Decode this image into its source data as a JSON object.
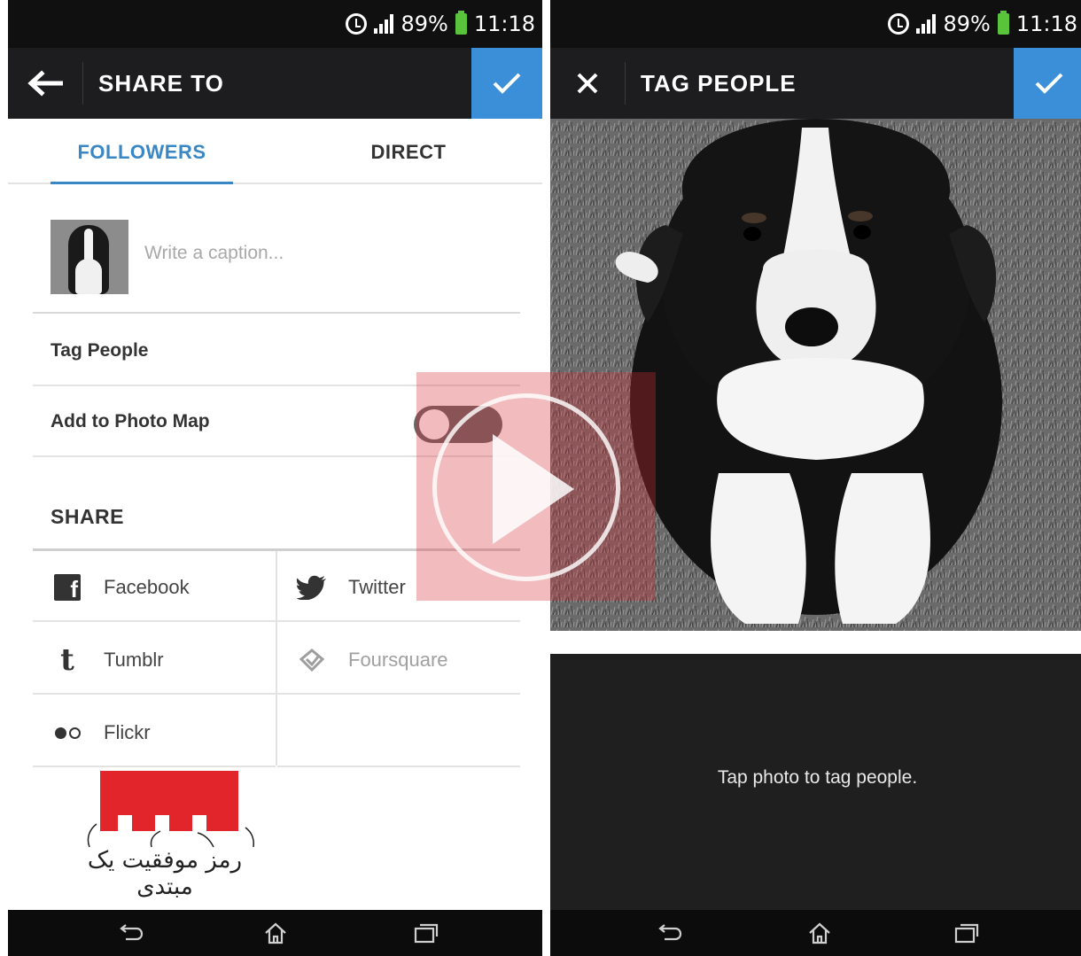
{
  "status_bar": {
    "battery": "89%",
    "time": "11:18"
  },
  "share_screen": {
    "title": "SHARE TO",
    "tabs": [
      {
        "label": "FOLLOWERS",
        "active": true
      },
      {
        "label": "DIRECT",
        "active": false
      }
    ],
    "caption_placeholder": "Write a caption...",
    "options": [
      {
        "label": "Tag People"
      },
      {
        "label": "Add to Photo Map",
        "toggle": "off"
      }
    ],
    "share_header": "SHARE",
    "share_targets": [
      {
        "label": "Facebook",
        "icon": "facebook-icon",
        "enabled": true
      },
      {
        "label": "Twitter",
        "icon": "twitter-icon",
        "enabled": true
      },
      {
        "label": "Tumblr",
        "icon": "tumblr-icon",
        "enabled": true
      },
      {
        "label": "Foursquare",
        "icon": "foursquare-icon",
        "enabled": false
      },
      {
        "label": "Flickr",
        "icon": "flickr-icon",
        "enabled": true
      }
    ]
  },
  "tag_screen": {
    "title": "TAG PEOPLE",
    "hint": "Tap photo to tag people."
  },
  "watermark": {
    "caption": "رمز موفقیت یک مبتدی"
  },
  "colors": {
    "accent": "#3b8fd9",
    "action_bar": "#1d1d1f",
    "status_bar": "#101010",
    "watermark_red": "#e1252b"
  },
  "icons": {
    "back": "arrow-left-icon",
    "close": "close-icon",
    "confirm": "checkmark-icon",
    "nav": [
      "back-nav-icon",
      "home-icon",
      "recents-icon"
    ]
  }
}
